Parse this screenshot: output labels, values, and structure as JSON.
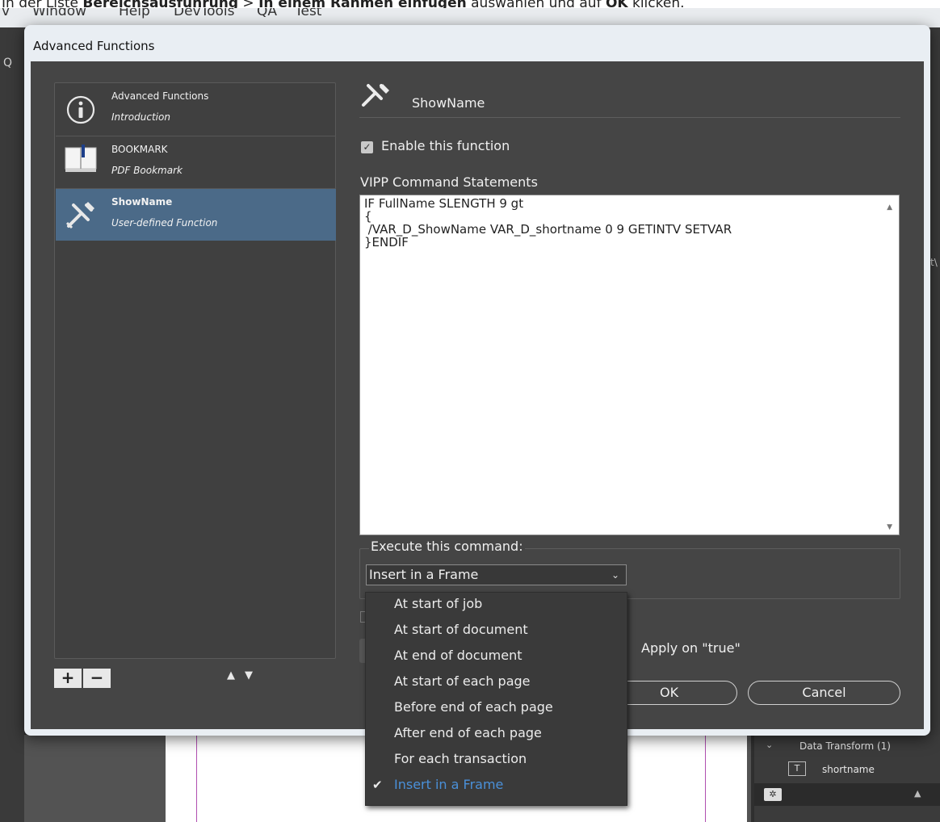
{
  "instruction": {
    "prefix": "In der Liste ",
    "bold1": "Bereichsausführung",
    "mid": " > ",
    "bold2": "In einem Rahmen einfügen",
    "suffix": " auswählen und auf ",
    "bold3": "OK",
    "end": " klicken."
  },
  "menubar": {
    "items": [
      "v",
      "Window",
      "Help",
      "DevTools",
      "QA",
      "Test"
    ]
  },
  "dialog": {
    "title": "Advanced Functions",
    "functions": [
      {
        "title": "Advanced Functions",
        "subtitle": "Introduction",
        "icon": "info-icon"
      },
      {
        "title": "BOOKMARK",
        "subtitle": "PDF Bookmark",
        "icon": "book-icon"
      },
      {
        "title": "ShowName",
        "subtitle": "User-defined Function",
        "icon": "tools-icon",
        "selected": true
      }
    ],
    "list_buttons": {
      "add": "+",
      "remove": "−",
      "up": "🠕",
      "down": "🠗"
    },
    "header_name": "ShowName",
    "enable_label": "Enable this function",
    "enable_checked": true,
    "vipp_label": "VIPP Command Statements",
    "vipp_code": "IF FullName SLENGTH 9 gt\n{\n /VAR_D_ShowName VAR_D_shortname 0 9 GETINTV SETVAR\n}ENDIF",
    "execute_label": "Execute this command:",
    "execute_value": "Insert in a Frame",
    "apply_label": "Apply on \"true\"",
    "ok_label": "OK",
    "cancel_label": "Cancel"
  },
  "dropdown": {
    "options": [
      "At start of job",
      "At start of document",
      "At end of document",
      "At start of each page",
      "Before end of each page",
      "After end of each page",
      "For each transaction",
      "Insert in a Frame"
    ],
    "selected": "Insert in a Frame",
    "selected_color": "#4a90d9"
  },
  "right_panel": {
    "transform_label": "Data Transform (1)",
    "shortname_label": "shortname"
  },
  "side_marks": {
    "left": "Q",
    "right": "t\\"
  }
}
